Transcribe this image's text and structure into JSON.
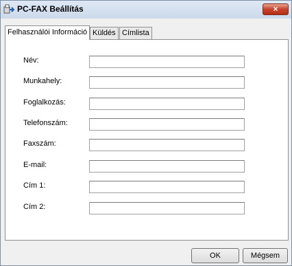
{
  "window": {
    "title": "PC-FAX Beállítás",
    "close_label": "×"
  },
  "tabs": [
    {
      "label": "Felhasználói Információ"
    },
    {
      "label": "Küldés"
    },
    {
      "label": "Címlista"
    }
  ],
  "form": {
    "fields": [
      {
        "label": "Név:",
        "value": ""
      },
      {
        "label": "Munkahely:",
        "value": ""
      },
      {
        "label": "Foglalkozás:",
        "value": ""
      },
      {
        "label": "Telefonszám:",
        "value": ""
      },
      {
        "label": "Faxszám:",
        "value": ""
      },
      {
        "label": "E-mail:",
        "value": ""
      },
      {
        "label": "Cím 1:",
        "value": ""
      },
      {
        "label": "Cím 2:",
        "value": ""
      }
    ]
  },
  "buttons": {
    "ok_label": "OK",
    "cancel_label": "Mégsem"
  }
}
